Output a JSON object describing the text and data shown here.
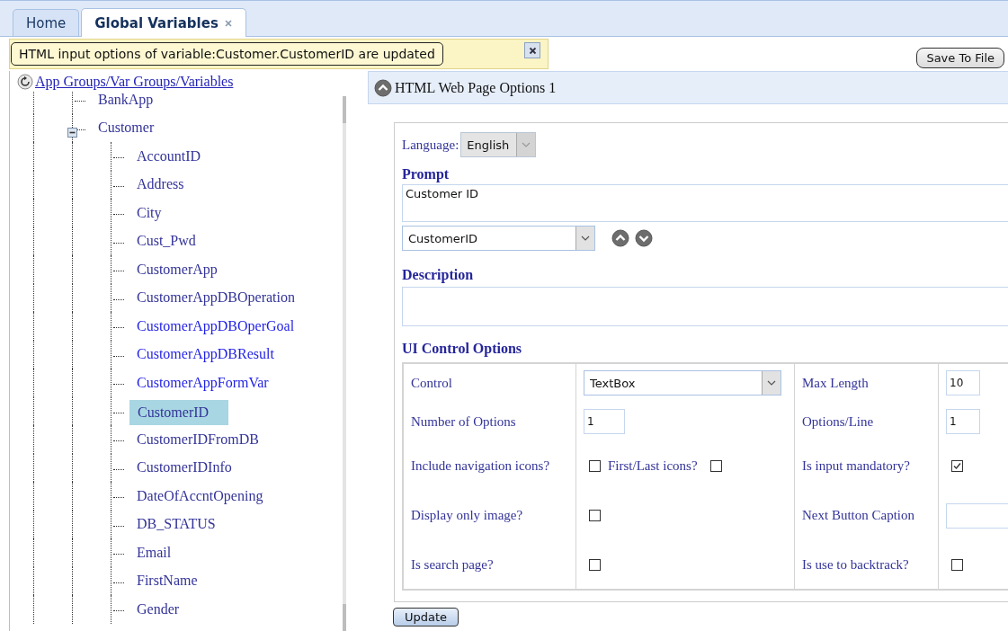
{
  "tabs": [
    {
      "label": "Home",
      "selected": false,
      "closable": false
    },
    {
      "label": "Global Variables",
      "selected": true,
      "closable": true
    }
  ],
  "notification": {
    "message": "HTML input options of variable:Customer.CustomerID are updated"
  },
  "save_button": "Save To File",
  "tree": {
    "title": "App Groups/Var Groups/Variables",
    "items": [
      {
        "label": "BankApp",
        "selected": false,
        "color": "#333399"
      },
      {
        "label": "Customer",
        "expanded": true,
        "selected": false,
        "color": "#333399",
        "children": [
          {
            "label": "AccountID",
            "selected": false,
            "color": "#333399"
          },
          {
            "label": "Address",
            "selected": false,
            "color": "#333399"
          },
          {
            "label": "City",
            "selected": false,
            "color": "#333399"
          },
          {
            "label": "Cust_Pwd",
            "selected": false,
            "color": "#333399"
          },
          {
            "label": "CustomerApp",
            "selected": false,
            "color": "#333399"
          },
          {
            "label": "CustomerAppDBOperation",
            "selected": false,
            "color": "#333399"
          },
          {
            "label": "CustomerAppDBOperGoal",
            "selected": false,
            "color": "#1f1fe6"
          },
          {
            "label": "CustomerAppDBResult",
            "selected": false,
            "color": "#1f1fe6"
          },
          {
            "label": "CustomerAppFormVar",
            "selected": false,
            "color": "#1f1fe6"
          },
          {
            "label": "CustomerID",
            "selected": true,
            "color": "#333399"
          },
          {
            "label": "CustomerIDFromDB",
            "selected": false,
            "color": "#333399"
          },
          {
            "label": "CustomerIDInfo",
            "selected": false,
            "color": "#333399"
          },
          {
            "label": "DateOfAccntOpening",
            "selected": false,
            "color": "#333399"
          },
          {
            "label": "DB_STATUS",
            "selected": false,
            "color": "#333399"
          },
          {
            "label": "Email",
            "selected": false,
            "color": "#333399"
          },
          {
            "label": "FirstName",
            "selected": false,
            "color": "#333399"
          },
          {
            "label": "Gender",
            "selected": false,
            "color": "#333399"
          }
        ]
      }
    ]
  },
  "panel": {
    "title": "HTML Web Page Options 1",
    "expanded": true
  },
  "form": {
    "language": {
      "label": "Language:",
      "value": "English",
      "disabled": true
    },
    "prompt": {
      "label": "Prompt",
      "value": "Customer ID"
    },
    "prompt_variable": {
      "value": "CustomerID"
    },
    "description": {
      "label": "Description"
    },
    "ui_options": {
      "title": "UI Control Options",
      "rows": [
        [
          [
            {
              "kind": "text",
              "text": "Control"
            }
          ],
          [
            {
              "kind": "select",
              "value": "TextBox"
            }
          ],
          [
            {
              "kind": "text",
              "text": "Max Length"
            }
          ],
          [
            {
              "kind": "input",
              "value": "10"
            }
          ]
        ],
        [
          [
            {
              "kind": "text",
              "text": "Number of Options"
            }
          ],
          [
            {
              "kind": "input",
              "value": "1"
            }
          ],
          [
            {
              "kind": "text",
              "text": "Options/Line"
            }
          ],
          [
            {
              "kind": "input",
              "value": "1"
            }
          ]
        ],
        [
          [
            {
              "kind": "text",
              "text": "Include navigation icons?"
            }
          ],
          [
            {
              "kind": "checkbox",
              "checked": false
            },
            {
              "kind": "text",
              "text": "First/Last icons?"
            },
            {
              "kind": "checkbox",
              "checked": false
            }
          ],
          [
            {
              "kind": "text",
              "text": "Is input mandatory?"
            }
          ],
          [
            {
              "kind": "checkbox",
              "checked": true
            }
          ]
        ],
        [
          [
            {
              "kind": "text",
              "text": "Display only image?"
            }
          ],
          [
            {
              "kind": "checkbox",
              "checked": false
            }
          ],
          [
            {
              "kind": "text",
              "text": "Next Button Caption"
            }
          ],
          [
            {
              "kind": "input"
            }
          ]
        ],
        [
          [
            {
              "kind": "text",
              "text": "Is search page?"
            }
          ],
          [
            {
              "kind": "checkbox",
              "checked": false
            }
          ],
          [
            {
              "kind": "text",
              "text": "Is use to backtrack?"
            }
          ],
          [
            {
              "kind": "checkbox",
              "checked": false
            }
          ]
        ]
      ]
    },
    "update_button": "Update"
  }
}
